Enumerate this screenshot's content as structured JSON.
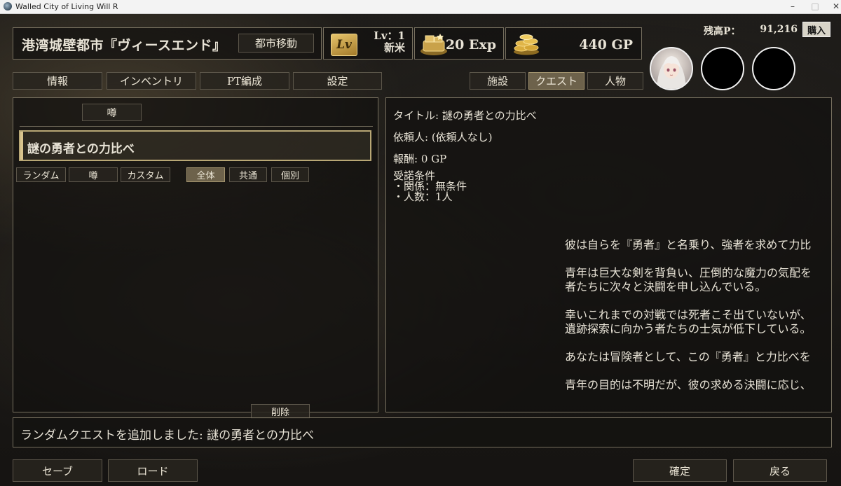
{
  "window": {
    "title": "Walled City of Living Will R",
    "min": "–",
    "max": "□",
    "close": "✕"
  },
  "header": {
    "city_name": "港湾城壁都市『ヴィースエンド』",
    "move_button": "都市移動",
    "level_icon": "Lv",
    "level_line1": "Lv：1",
    "level_line2": "新米",
    "exp": "20 Exp",
    "gp": "440 GP",
    "fame_label": "残高P：",
    "fame_value": "91,216",
    "buy_button": "購入"
  },
  "tabs_left": [
    "情報",
    "インベントリ",
    "PT編成",
    "設定"
  ],
  "tabs_right": [
    "施設",
    "クエスト",
    "人物"
  ],
  "active_right_tab": "クエスト",
  "quest_list": {
    "section_label": "噂",
    "items": [
      "謎の勇者との力比べ"
    ],
    "filters_source": [
      "ランダム",
      "噂",
      "カスタム"
    ],
    "filters_scope": [
      "全体",
      "共通",
      "個別"
    ],
    "active_scope": "全体",
    "delete_button": "削除"
  },
  "quest_detail": {
    "title_line": "タイトル: 謎の勇者との力比べ",
    "client_line": "依頼人: (依頼人なし)",
    "reward_line": "報酬: 0 GP",
    "conditions_header": "受諾条件",
    "condition_1": "・関係：無条件",
    "condition_2": "・人数：1人",
    "description": [
      "彼は自らを『勇者』と名乗り、強者を求めて力比",
      "青年は巨大な剣を背負い、圧倒的な魔力の気配を",
      "者たちに次々と決闘を申し込んでいる。",
      "幸いこれまでの対戦では死者こそ出ていないが、",
      "遺跡探索に向かう者たちの士気が低下している。",
      "あなたは冒険者として、この『勇者』と力比べを",
      "青年の目的は不明だが、彼の求める決闘に応じ、"
    ]
  },
  "message": "ランダムクエストを追加しました: 謎の勇者との力比べ",
  "footer": {
    "save": "セーブ",
    "load": "ロード",
    "confirm": "確定",
    "back": "戻る"
  }
}
